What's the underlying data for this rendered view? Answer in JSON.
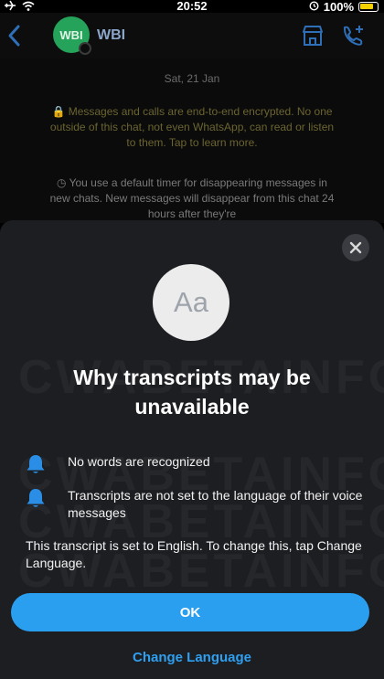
{
  "status_bar": {
    "time": "20:52",
    "battery_text": "100%",
    "icons": [
      "airplane-icon",
      "wifi-icon",
      "alarm-icon",
      "battery-icon"
    ]
  },
  "chat": {
    "title": "WBI",
    "avatar_text": "WBI",
    "date": "Sat, 21 Jan",
    "encryption_notice": "🔒 Messages and calls are end-to-end encrypted. No one outside of this chat, not even WhatsApp, can read or listen to them. Tap to learn more.",
    "timer_notice": "◷ You use a default timer for disappearing messages in new chats. New messages will disappear from this chat 24 hours after they're"
  },
  "sheet": {
    "icon_text": "Aa",
    "title": "Why transcripts may be unavailable",
    "reasons": [
      {
        "icon": "bell-icon",
        "text": "No words are recognized"
      },
      {
        "icon": "bell-icon",
        "text": "Transcripts are not set to the language of their voice messages"
      }
    ],
    "info": "This transcript is set to English. To change this, tap Change Language.",
    "ok_label": "OK",
    "change_language_label": "Change Language",
    "watermark": "CWABETAINFO"
  },
  "colors": {
    "accent": "#2a9ff0",
    "sheet_bg": "#1d1e21",
    "avatar_green": "#25a35a"
  }
}
